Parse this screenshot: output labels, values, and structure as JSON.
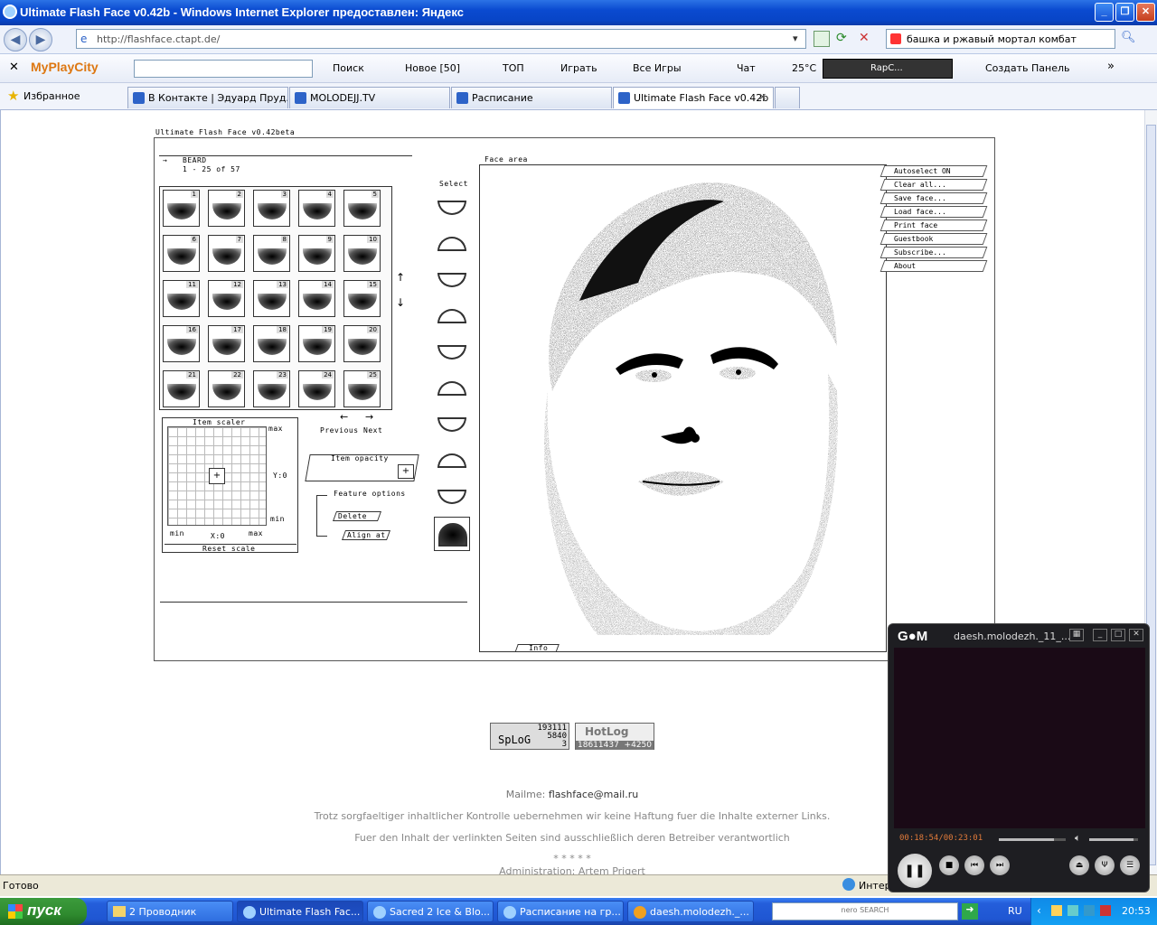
{
  "window": {
    "title": "Ultimate Flash Face v0.42b - Windows Internet Explorer предоставлен: Яндекс"
  },
  "address": {
    "url": "http://flashface.ctapt.de/",
    "search_value": "башка и ржавый мортал комбат"
  },
  "toolbar": {
    "logo": "MyPlayCity",
    "items": [
      "Поиск",
      "Новое [50]",
      "ТОП",
      "Играть",
      "Все Игры",
      "Чат",
      "25°C",
      "RapC...",
      "Создать Панель"
    ]
  },
  "favbar": {
    "favorites_label": "Избранное",
    "tabs": [
      {
        "label": "В Контакте | Эдуард Пруд..."
      },
      {
        "label": "MOLODEJJ.TV"
      },
      {
        "label": "Расписание"
      },
      {
        "label": "Ultimate Flash Face v0.42b"
      }
    ]
  },
  "flash": {
    "app_title": "Ultimate Flash Face v0.42beta",
    "category": "BEARD",
    "range": "1 - 25 of 57",
    "select_label": "Select",
    "face_area_label": "Face area",
    "cells": [
      "1",
      "2",
      "3",
      "4",
      "5",
      "6",
      "7",
      "8",
      "9",
      "10",
      "11",
      "12",
      "13",
      "14",
      "15",
      "16",
      "17",
      "18",
      "19",
      "20",
      "21",
      "22",
      "23",
      "24",
      "25"
    ],
    "prev_label": "Previous",
    "next_label": "Next",
    "item_scaler": {
      "title": "Item scaler",
      "max": "max",
      "min": "min",
      "y": "Y:0",
      "x": "X:0",
      "reset": "Reset scale"
    },
    "item_opacity": "Item opacity",
    "feature_options": {
      "title": "Feature options",
      "delete": "Delete",
      "align": "Align at"
    },
    "menu": [
      "Autoselect ON",
      "Clear all...",
      "Save face...",
      "Load face...",
      "Print face",
      "Guestbook",
      "Subscribe...",
      "About"
    ],
    "info_label": "Info"
  },
  "page": {
    "counter1": {
      "line1": "193111",
      "line2": "5840",
      "line3": "3",
      "brand": "SpLoG"
    },
    "counter2": {
      "brand": "HotLog",
      "line1": "18611437",
      "line2": "+4250"
    },
    "mail_label": "Mailme:",
    "mail": "flashface@mail.ru",
    "disclaimer1": "Trotz sorgfaeltiger inhaltlicher Kontrolle uebernehmen wir keine Haftung fuer die Inhalte externer Links.",
    "disclaimer2": "Fuer den Inhalt der verlinkten Seiten sind ausschließlich deren Betreiber verantwortlich",
    "stars": "* * * * *",
    "admin": "Administration: Artem Prigert"
  },
  "status": {
    "text": "Готово",
    "zone": "Интер"
  },
  "gom": {
    "title": "daesh.molodezh._11_...",
    "time": "00:18:54/00:23:01",
    "progress": 0.82,
    "volume": 0.9
  },
  "taskbar": {
    "start": "пуск",
    "tasks": [
      "2 Проводник",
      "Ultimate Flash Fac...",
      "Sacred 2 Ice & Blo...",
      "Расписание на гр...",
      "daesh.molodezh._..."
    ],
    "search_brand": "nero SEARCH",
    "lang": "RU",
    "clock": "20:53"
  }
}
